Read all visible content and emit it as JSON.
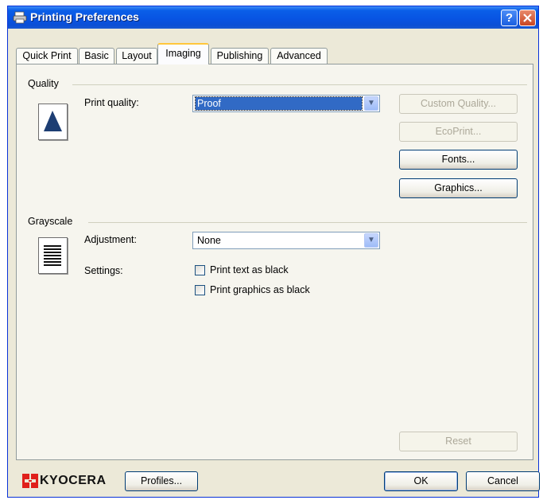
{
  "window": {
    "title": "Printing Preferences"
  },
  "tabs": [
    {
      "label": "Quick Print"
    },
    {
      "label": "Basic"
    },
    {
      "label": "Layout"
    },
    {
      "label": "Imaging"
    },
    {
      "label": "Publishing"
    },
    {
      "label": "Advanced"
    }
  ],
  "active_tab": "Imaging",
  "quality": {
    "group_label": "Quality",
    "print_quality_label": "Print quality:",
    "print_quality_value": "Proof",
    "custom_quality_button": "Custom Quality...",
    "ecoprint_button": "EcoPrint...",
    "fonts_button": "Fonts...",
    "graphics_button": "Graphics..."
  },
  "grayscale": {
    "group_label": "Grayscale",
    "adjustment_label": "Adjustment:",
    "adjustment_value": "None",
    "settings_label": "Settings:",
    "print_text_black": "Print text as black",
    "print_graphics_black": "Print graphics as black",
    "print_text_black_checked": false,
    "print_graphics_black_checked": false
  },
  "reset_button": "Reset",
  "footer": {
    "brand": "KYOCERA",
    "profiles_button": "Profiles...",
    "ok_button": "OK",
    "cancel_button": "Cancel"
  },
  "colors": {
    "titlebar": "#0854e3",
    "dialog_bg": "#ece9d8",
    "selection": "#316ac5",
    "kyocera_red": "#e0201b",
    "active_tab_accent": "#ffc73c"
  }
}
